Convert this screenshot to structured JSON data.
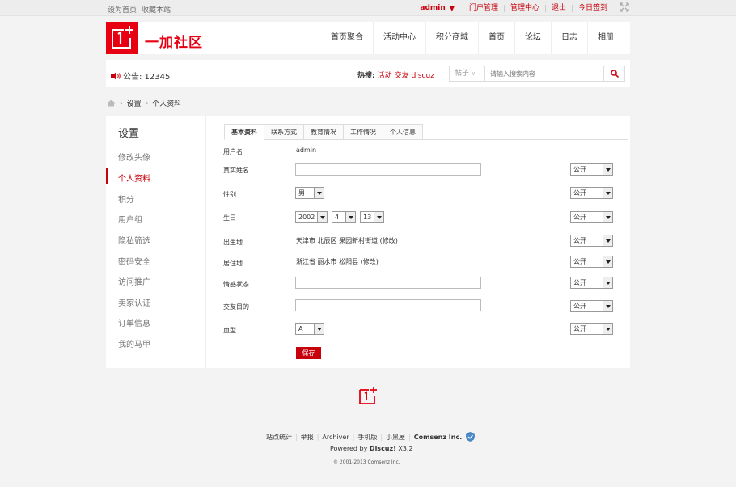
{
  "topbar": {
    "set_home": "设为首页",
    "bookmark": "收藏本站",
    "user": "admin",
    "links": [
      "门户管理",
      "管理中心",
      "退出",
      "今日签到"
    ]
  },
  "header": {
    "logo_text": "一加社区",
    "nav": [
      "首页聚合",
      "活动中心",
      "积分商城",
      "首页",
      "论坛",
      "日志",
      "相册"
    ]
  },
  "notice": {
    "text": "公告: 12345",
    "hot_label": "热搜:",
    "hot_terms": [
      "活动",
      "交友",
      "discuz"
    ]
  },
  "search": {
    "type": "帖子",
    "placeholder": "请输入搜索内容"
  },
  "breadcrumb": [
    "设置",
    "个人资料"
  ],
  "sidebar": {
    "title": "设置",
    "items": [
      "修改头像",
      "个人资料",
      "积分",
      "用户组",
      "隐私筛选",
      "密码安全",
      "访问推广",
      "卖家认证",
      "订单信息",
      "我的马甲"
    ],
    "active": "个人资料"
  },
  "tabs": [
    "基本资料",
    "联系方式",
    "教育情况",
    "工作情况",
    "个人信息"
  ],
  "form": {
    "username_label": "用户名",
    "username": "admin",
    "realname_label": "真实姓名",
    "gender_label": "性别",
    "gender": "男",
    "birthday_label": "生日",
    "birth_year": "2002",
    "birth_month": "4",
    "birth_day": "13",
    "birthplace_label": "出生地",
    "birthplace": "天津市 北辰区 果园新村街道 (修改)",
    "residence_label": "居住地",
    "residence": "浙江省 丽水市 松阳县 (修改)",
    "affective_label": "情感状态",
    "purpose_label": "交友目的",
    "blood_label": "血型",
    "blood": "A",
    "privacy": "公开",
    "save": "保存"
  },
  "footer": {
    "links": [
      "站点统计",
      "举报",
      "Archiver",
      "手机版",
      "小黑屋"
    ],
    "company": "Comsenz Inc.",
    "powered_prefix": "Powered by",
    "powered_product": "Discuz!",
    "version": "X3.2",
    "copyright": "© 2001-2013 Comsenz Inc."
  },
  "colors": {
    "brand": "#e60012",
    "accent": "#c7000b"
  }
}
